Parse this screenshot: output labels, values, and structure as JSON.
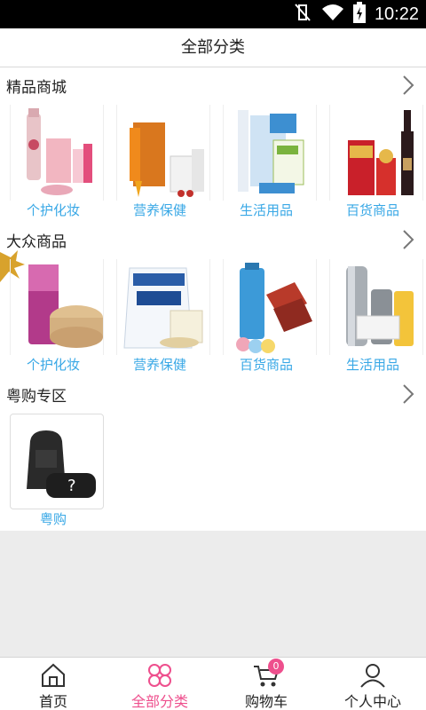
{
  "status_bar": {
    "time": "10:22"
  },
  "header": {
    "title": "全部分类"
  },
  "sections": [
    {
      "title": "精品商城",
      "items": [
        {
          "label": "个护化妆"
        },
        {
          "label": "营养保健"
        },
        {
          "label": "生活用品"
        },
        {
          "label": "百货商品"
        }
      ]
    },
    {
      "title": "大众商品",
      "items": [
        {
          "label": "个护化妆"
        },
        {
          "label": "营养保健"
        },
        {
          "label": "百货商品"
        },
        {
          "label": "生活用品"
        }
      ]
    },
    {
      "title": "粤购专区",
      "items": [
        {
          "label": "粤购"
        }
      ]
    }
  ],
  "bottom_nav": {
    "items": [
      {
        "label": "首页",
        "icon": "home-icon"
      },
      {
        "label": "全部分类",
        "icon": "category-icon"
      },
      {
        "label": "购物车",
        "icon": "cart-icon"
      },
      {
        "label": "个人中心",
        "icon": "user-icon"
      }
    ],
    "active_index": 1,
    "cart_badge": "0"
  },
  "colors": {
    "accent": "#ee4f8d",
    "label": "#39a8e6"
  }
}
